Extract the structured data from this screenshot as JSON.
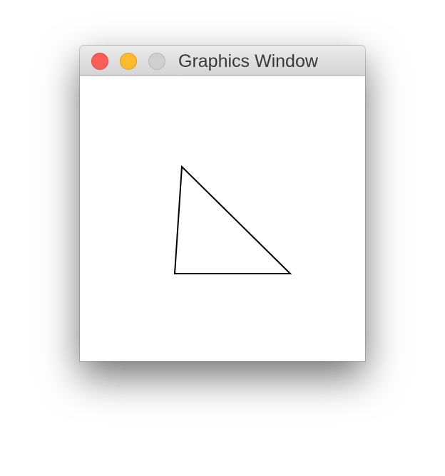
{
  "window": {
    "title": "Graphics Window",
    "controls": {
      "close_color": "#fc5f57",
      "minimize_color": "#fdbc2e",
      "zoom_color": "#cfcfcf"
    }
  },
  "canvas": {
    "background": "#ffffff",
    "shapes": [
      {
        "type": "triangle",
        "stroke": "#000000",
        "fill": "none"
      }
    ]
  }
}
